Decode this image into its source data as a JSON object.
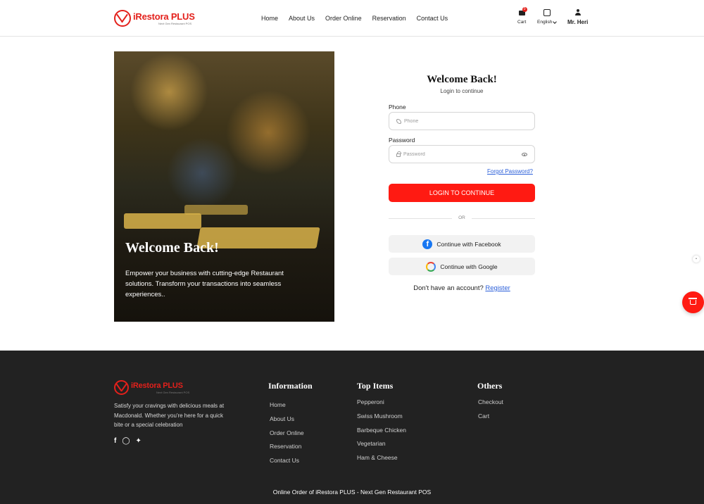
{
  "brand": {
    "name": "iRestora PLUS",
    "tagline": "Next Gen Restaurant POS",
    "color": "#e3201b"
  },
  "nav": {
    "items": [
      "Home",
      "About Us",
      "Order Online",
      "Reservation",
      "Contact Us"
    ]
  },
  "header_tools": {
    "cart_label": "Cart",
    "cart_count": "0",
    "language_label": "English",
    "user_name": "Mr. Heri"
  },
  "hero": {
    "title": "Welcome Back!",
    "description": "Empower your business with cutting-edge Restaurant solutions. Transform your transactions into seamless experiences.."
  },
  "login": {
    "title": "Welcome Back!",
    "subtitle": "Login to continue",
    "phone_label": "Phone",
    "phone_placeholder": "Phone",
    "password_label": "Password",
    "password_placeholder": "Password",
    "forgot_label": "Forgot Password?",
    "submit_label": "LOGIN TO CONTINUE",
    "submit_color": "#ff1a12",
    "or_label": "OR",
    "facebook_label": "Continue with Facebook",
    "google_label": "Continue with Google",
    "no_account_text": "Don't have an account?",
    "register_label": "Register"
  },
  "footer": {
    "description": "Satisfy your cravings with delicious meals at Macdonald. Whether you're here for a quick bite or a special celebration",
    "social": [
      "facebook-icon",
      "instagram-icon",
      "twitter-icon"
    ],
    "information": {
      "title": "Information",
      "items": [
        "Home",
        "About Us",
        "Order Online",
        "Reservation",
        "Contact Us"
      ]
    },
    "top_items": {
      "title": "Top Items",
      "items": [
        "Pepperoni",
        "Swiss Mushroom",
        "Barbeque Chicken",
        "Vegetarian",
        "Ham & Cheese"
      ]
    },
    "others": {
      "title": "Others",
      "items": [
        "Checkout",
        "Cart"
      ]
    },
    "copyright": "Online Order of iRestora PLUS - Next Gen Restaurant POS",
    "background": "#222222"
  }
}
